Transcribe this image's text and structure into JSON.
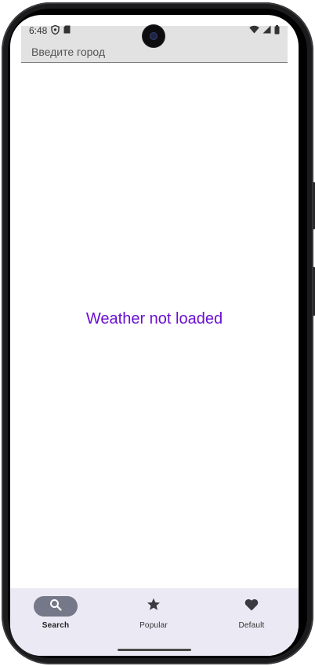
{
  "status": {
    "time": "6:48",
    "left_icons": [
      "shield-icon",
      "sd-card-icon"
    ],
    "right_icons": [
      "wifi-icon",
      "signal-icon",
      "battery-icon"
    ]
  },
  "search": {
    "placeholder": "Введите город",
    "value": ""
  },
  "main": {
    "message": "Weather not loaded",
    "message_color": "#6a0fd2"
  },
  "nav": {
    "items": [
      {
        "label": "Search",
        "icon": "search-icon",
        "active": true
      },
      {
        "label": "Popular",
        "icon": "star-icon",
        "active": false
      },
      {
        "label": "Default",
        "icon": "heart-icon",
        "active": false
      }
    ]
  },
  "colors": {
    "nav_background": "#ebe9f3",
    "active_indicator": "#747888",
    "search_background": "#e2e2e2"
  }
}
